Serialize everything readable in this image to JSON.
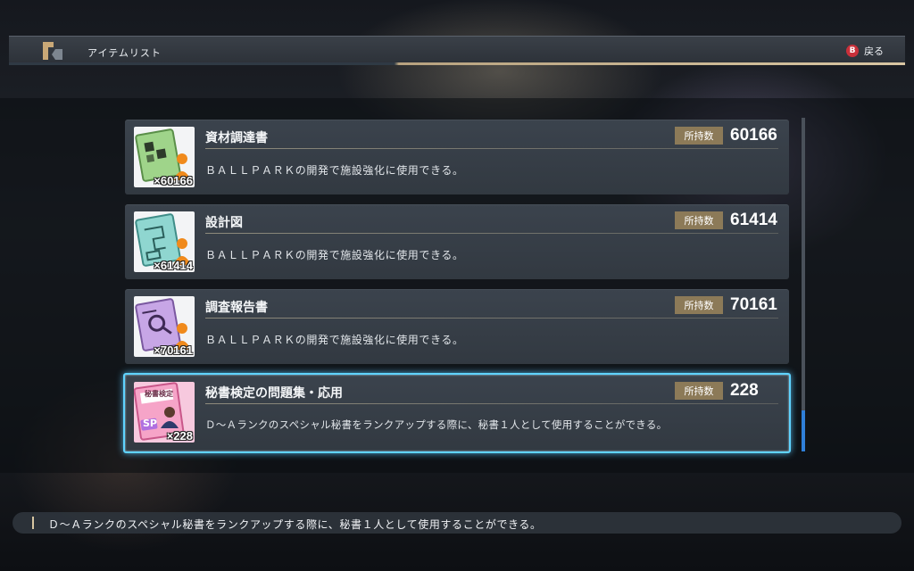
{
  "header": {
    "title": "アイテムリスト",
    "back_key": "B",
    "back_label": "戻る"
  },
  "items": [
    {
      "name": "資材調達書",
      "owned_label": "所持数",
      "count": "60166",
      "thumb_qty": "×60166",
      "description": "ＢＡＬＬＰＡＲＫの開発で施設強化に使用できる。",
      "icon": "materials-document-icon"
    },
    {
      "name": "設計図",
      "owned_label": "所持数",
      "count": "61414",
      "thumb_qty": "×61414",
      "description": "ＢＡＬＬＰＡＲＫの開発で施設強化に使用できる。",
      "icon": "blueprint-icon"
    },
    {
      "name": "調査報告書",
      "owned_label": "所持数",
      "count": "70161",
      "thumb_qty": "×70161",
      "description": "ＢＡＬＬＰＡＲＫの開発で施設強化に使用できる。",
      "icon": "survey-report-icon"
    },
    {
      "name": "秘書検定の問題集・応用",
      "owned_label": "所持数",
      "count": "228",
      "thumb_qty": "×228",
      "description": "Ｄ～Ａランクのスペシャル秘書をランクアップする際に、秘書１人として使用することができる。",
      "icon": "secretary-exam-book-icon",
      "thumb_text": "秘書検定",
      "thumb_badge": "SP",
      "selected": true
    }
  ],
  "footer": {
    "description": "Ｄ～Ａランクのスペシャル秘書をランクアップする際に、秘書１人として使用することができる。"
  },
  "colors": {
    "selection_glow": "#5fd3ff",
    "owned_badge": "#8c7a58",
    "scroll_thumb": "#2f7fd8",
    "back_button": "#c9303a"
  }
}
